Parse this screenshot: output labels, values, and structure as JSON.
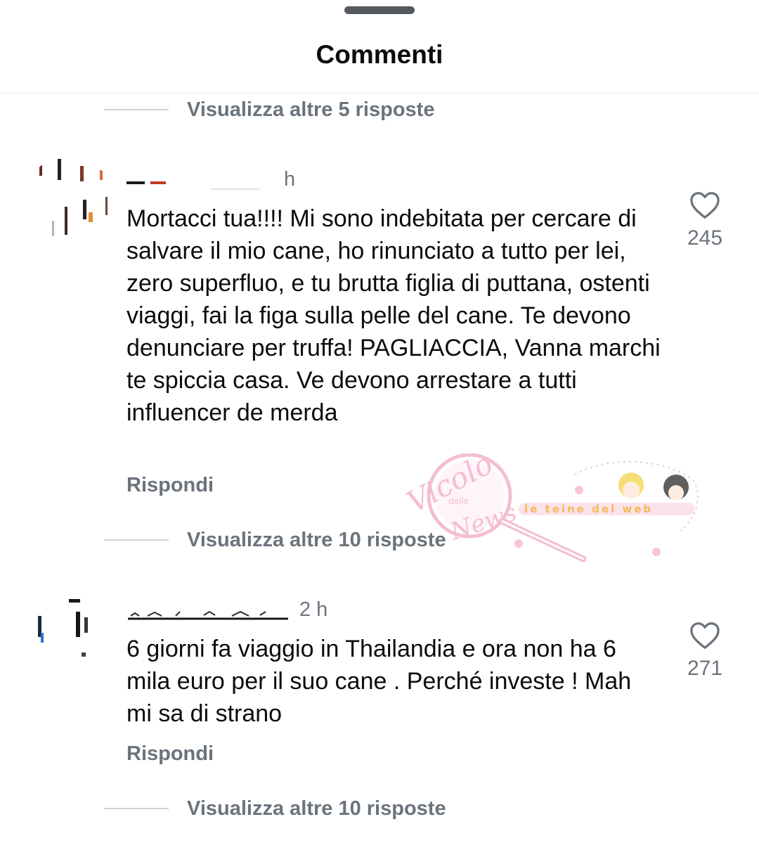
{
  "sheet": {
    "title": "Commenti"
  },
  "thread_top": {
    "view_more_label": "Visualizza altre 5 risposte"
  },
  "comments": [
    {
      "username": "",
      "time": "h",
      "text": "Mortacci tua!!!! Mi sono indebitata per cercare di salvare il mio cane, ho rinunciato a tutto per lei,  zero superfluo, e tu brutta figlia di puttana, ostenti viaggi, fai la figa sulla pelle del cane. Te devono denunciare per truffa! PAGLIACCIA, Vanna marchi te spiccia casa. Ve devono arrestare a tutti influencer de merda",
      "reply_label": "Rispondi",
      "likes": "245",
      "view_more_label": "Visualizza altre 10 risposte"
    },
    {
      "username": "",
      "time": "2 h",
      "text": "6 giorni fa viaggio in Thailandia e ora non ha 6 mila euro per il suo cane . Perché investe ! Mah mi sa di strano",
      "reply_label": "Rispondi",
      "likes": "271",
      "view_more_label": "Visualizza altre 10 risposte"
    }
  ],
  "watermark": {
    "logo_text": "Vicolo delle News",
    "banner_text": "le teine del web"
  },
  "icons": {
    "like": "heart-outline-icon",
    "handle": "drag-handle-icon"
  },
  "colors": {
    "text_primary": "#0c0c0c",
    "text_secondary": "#6b737c",
    "divider": "#e6e7ea",
    "handle": "#555a61"
  }
}
